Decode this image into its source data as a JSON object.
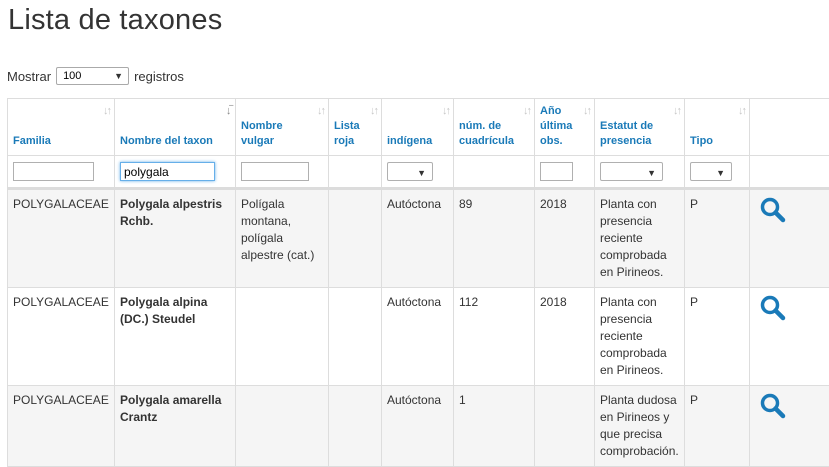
{
  "page": {
    "title": "Lista de taxones"
  },
  "length_menu": {
    "show_label": "Mostrar",
    "selected": "100",
    "records_label": "registros"
  },
  "columns": [
    {
      "label": "Familia"
    },
    {
      "label": "Nombre del taxon"
    },
    {
      "label": "Nombre vulgar"
    },
    {
      "label": "Lista roja"
    },
    {
      "label": "indígena"
    },
    {
      "label": "núm. de cuadrícula"
    },
    {
      "label": "Año última obs."
    },
    {
      "label": "Estatut de presencia"
    },
    {
      "label": "Tipo"
    }
  ],
  "filters": {
    "taxon_value": "polygala"
  },
  "rows": [
    {
      "familia": "POLYGALACEAE",
      "taxon": "Polygala alpestris Rchb.",
      "vulgar": "Polígala montana, polígala alpestre (cat.)",
      "lista_roja": "",
      "indigena": "Autóctona",
      "cuadricula": "89",
      "anio": "2018",
      "estatut": "Planta con presencia reciente comprobada en Pirineos.",
      "tipo": "P"
    },
    {
      "familia": "POLYGALACEAE",
      "taxon": "Polygala alpina (DC.) Steudel",
      "vulgar": "",
      "lista_roja": "",
      "indigena": "Autóctona",
      "cuadricula": "112",
      "anio": "2018",
      "estatut": "Planta con presencia reciente comprobada en Pirineos.",
      "tipo": "P"
    },
    {
      "familia": "POLYGALACEAE",
      "taxon": "Polygala amarella Crantz",
      "vulgar": "",
      "lista_roja": "",
      "indigena": "Autóctona",
      "cuadricula": "1",
      "anio": "",
      "estatut": "Planta dudosa en Pirineos y que precisa comprobación.",
      "tipo": "P"
    }
  ],
  "icons": {
    "detail": "search-icon"
  },
  "colors": {
    "header_text": "#1a7ab8",
    "icon": "#1a7ab8",
    "row_odd": "#f5f5f5"
  }
}
